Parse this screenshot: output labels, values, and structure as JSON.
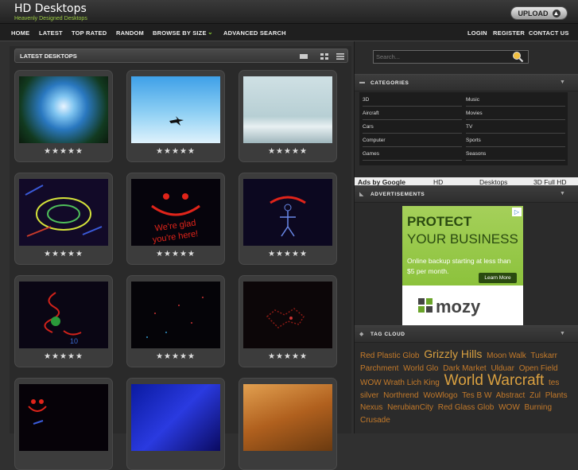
{
  "header": {
    "title": "HD Desktops",
    "tagline": "Heavenly Designed Desktops",
    "upload_label": "UPLOAD"
  },
  "nav": {
    "home": "HOME",
    "latest": "LATEST",
    "top_rated": "TOP RATED",
    "random": "RANDOM",
    "browse": "BROWSE BY SIZE",
    "advanced": "ADVANCED SEARCH",
    "login": "LOGIN",
    "register": "REGISTER",
    "contact": "CONTACT US"
  },
  "main": {
    "section_title": "LATEST DESKTOPS",
    "rating_stars": "★★★★★"
  },
  "sidebar": {
    "search_placeholder": "Search...",
    "categories_title": "CATEGORIES",
    "categories": [
      "3D",
      "Music",
      "Aircraft",
      "Movies",
      "Cars",
      "TV",
      "Computer",
      "Sports",
      "Games",
      "Seasons"
    ],
    "ad_links": [
      "Ads by Google",
      "HD",
      "Desktops",
      "3D Full HD"
    ],
    "ads_title": "ADVERTISEMENTS",
    "ad": {
      "headline1": "PROTECT",
      "headline2": "YOUR BUSINESS",
      "body": "Online backup starting at less than $5 per month.",
      "button": "Learn More",
      "brand": "mozy"
    },
    "tag_cloud_title": "TAG CLOUD",
    "tags": [
      {
        "text": "Red Plastic Glob",
        "size": 10
      },
      {
        "text": "Grizzly Hills",
        "size": 14
      },
      {
        "text": "Moon Walk",
        "size": 10
      },
      {
        "text": "Tuskarr",
        "size": 10
      },
      {
        "text": "Parchment",
        "size": 10
      },
      {
        "text": "World Glo",
        "size": 10
      },
      {
        "text": "Dark Market",
        "size": 10
      },
      {
        "text": "Ulduar",
        "size": 10
      },
      {
        "text": "Open Field",
        "size": 10
      },
      {
        "text": "WOW Wrath Lich King",
        "size": 10
      },
      {
        "text": "World Warcraft",
        "size": 19
      },
      {
        "text": "tes",
        "size": 10
      },
      {
        "text": "silver",
        "size": 10
      },
      {
        "text": "Northrend",
        "size": 10
      },
      {
        "text": "WoWlogo",
        "size": 10
      },
      {
        "text": "Tes B W",
        "size": 10
      },
      {
        "text": "Abstract",
        "size": 10
      },
      {
        "text": "Zul",
        "size": 10
      },
      {
        "text": "Plants",
        "size": 10
      },
      {
        "text": "Nexus",
        "size": 10
      },
      {
        "text": "NerubianCity",
        "size": 10
      },
      {
        "text": "Red Glass Glob",
        "size": 10
      },
      {
        "text": "WOW",
        "size": 10
      },
      {
        "text": "Burning Crusade",
        "size": 10
      }
    ]
  },
  "colors": {
    "accent": "#9ccc44",
    "tag": "#c47a2a"
  }
}
